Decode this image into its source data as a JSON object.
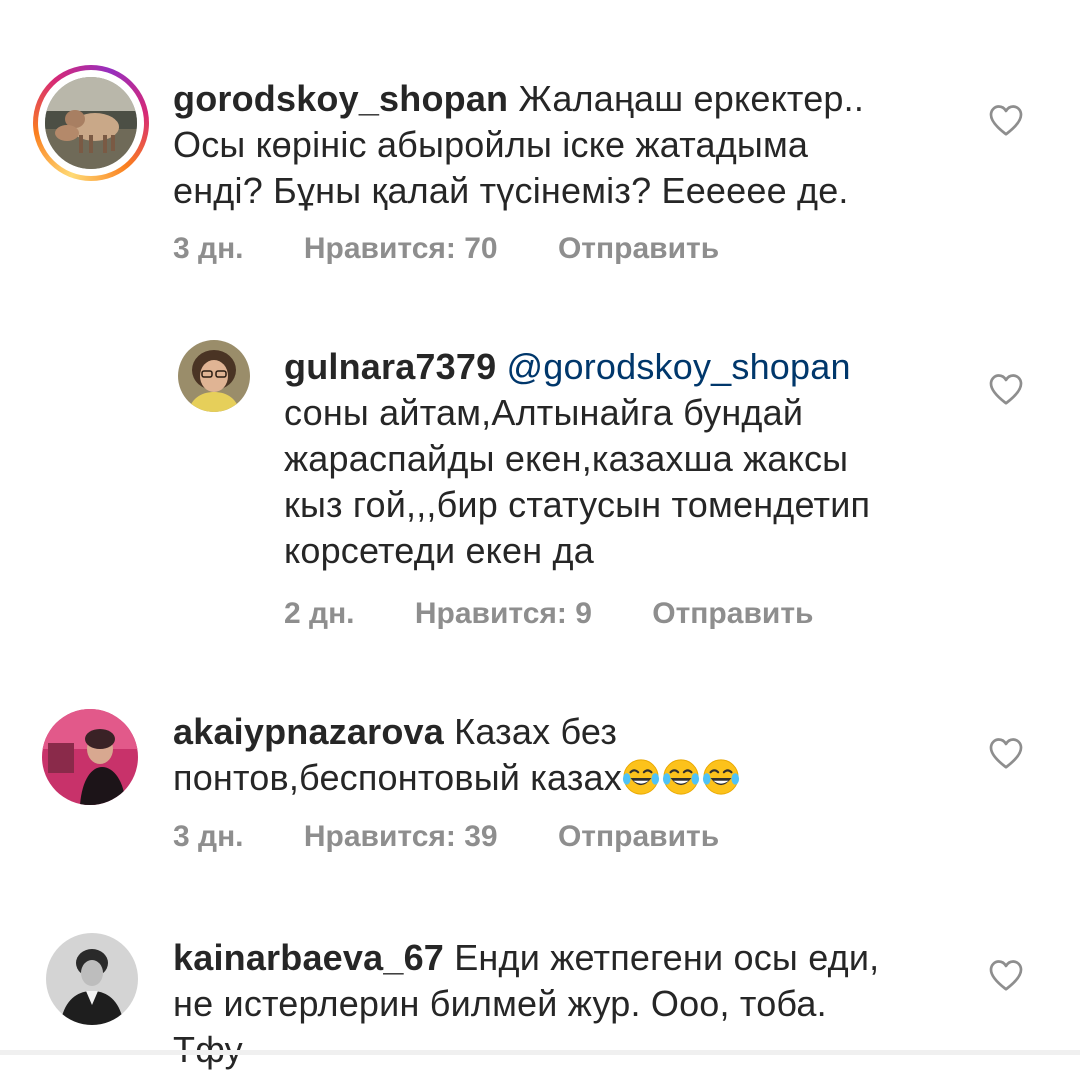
{
  "comments": [
    {
      "username": "gorodskoy_shopan",
      "text_line1": "Жалаңаш еркектер..",
      "text_line2": "Осы көрініс абыройлы іске жатадыма",
      "text_line3": "енді? Бұны қалай түсінеміз? Ееееее де.",
      "time": "3 дн.",
      "likes": "Нравится: 70",
      "reply_label": "Отправить",
      "avatar_icon": "avatar-sheep-photo",
      "has_story_ring": true
    },
    {
      "username": "gulnara7379",
      "mention": "@gorodskoy_shopan",
      "text_line1": "соны айтам,Алтынайга бундай",
      "text_line2": "жараспайды екен,казахша жаксы",
      "text_line3": "кыз гой,,,бир статусын томендетип",
      "text_line4": "корсетеди екен да",
      "time": "2 дн.",
      "likes": "Нравится: 9",
      "reply_label": "Отправить",
      "avatar_icon": "avatar-woman-glasses-photo"
    },
    {
      "username": "akaiypnazarova",
      "text_line1": "Казах без",
      "text_line2": "понтов,беспонтовый казах",
      "emoji_count": 3,
      "emoji_icon": "face-with-tears-of-joy-emoji",
      "time": "3 дн.",
      "likes": "Нравится: 39",
      "reply_label": "Отправить",
      "avatar_icon": "avatar-woman-pink-photo"
    },
    {
      "username": "kainarbaeva_67",
      "text_line1": "Енди жетпегени осы еди,",
      "text_line2": "не истерлерин билмей жур. Ооо, тоба.",
      "text_line3": "Тфу",
      "avatar_icon": "avatar-bw-portrait-photo"
    }
  ],
  "icons": {
    "like": "heart-outline-icon"
  },
  "colors": {
    "username": "#262626",
    "text": "#262626",
    "meta": "#8e8e8e",
    "mention": "#00376b",
    "heart": "#8e8e8e"
  }
}
